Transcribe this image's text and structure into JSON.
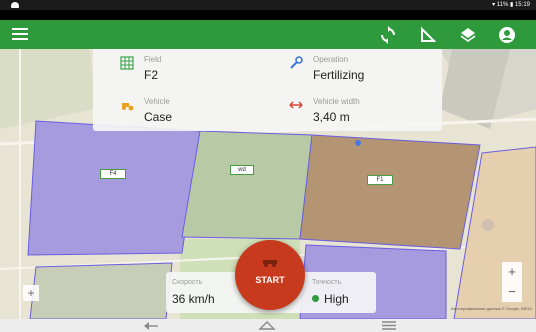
{
  "status_bar": {
    "right_text": "▾ 11% ▮ 15:19"
  },
  "app_bar": {
    "menu_icon": "hamburger-icon",
    "actions": [
      {
        "name": "sync-icon"
      },
      {
        "name": "measure-icon"
      },
      {
        "name": "layers-icon"
      },
      {
        "name": "account-icon"
      }
    ]
  },
  "info_card": {
    "field": {
      "label": "Field",
      "value": "F2",
      "icon": "grid-icon"
    },
    "operation": {
      "label": "Operation",
      "value": "Fertilizing",
      "icon": "wrench-icon"
    },
    "vehicle": {
      "label": "Vehicle",
      "value": "Case",
      "icon": "tractor-icon"
    },
    "vehicle_width": {
      "label": "Vehicle width",
      "value": "3,40 m",
      "icon": "width-arrows-icon"
    }
  },
  "map": {
    "field_labels": [
      "F4",
      "wd",
      "F1"
    ],
    "attribution": "Картографические данные © Google, INEGI"
  },
  "speed_card": {
    "speed": {
      "label": "Скорость",
      "value": "36 km/h"
    },
    "accuracy": {
      "label": "Точность",
      "value": "High",
      "status_color": "#2e9a3b"
    }
  },
  "start_button": {
    "label": "START"
  },
  "colors": {
    "accent": "#2e9a3b",
    "start": "#c83a1e"
  }
}
